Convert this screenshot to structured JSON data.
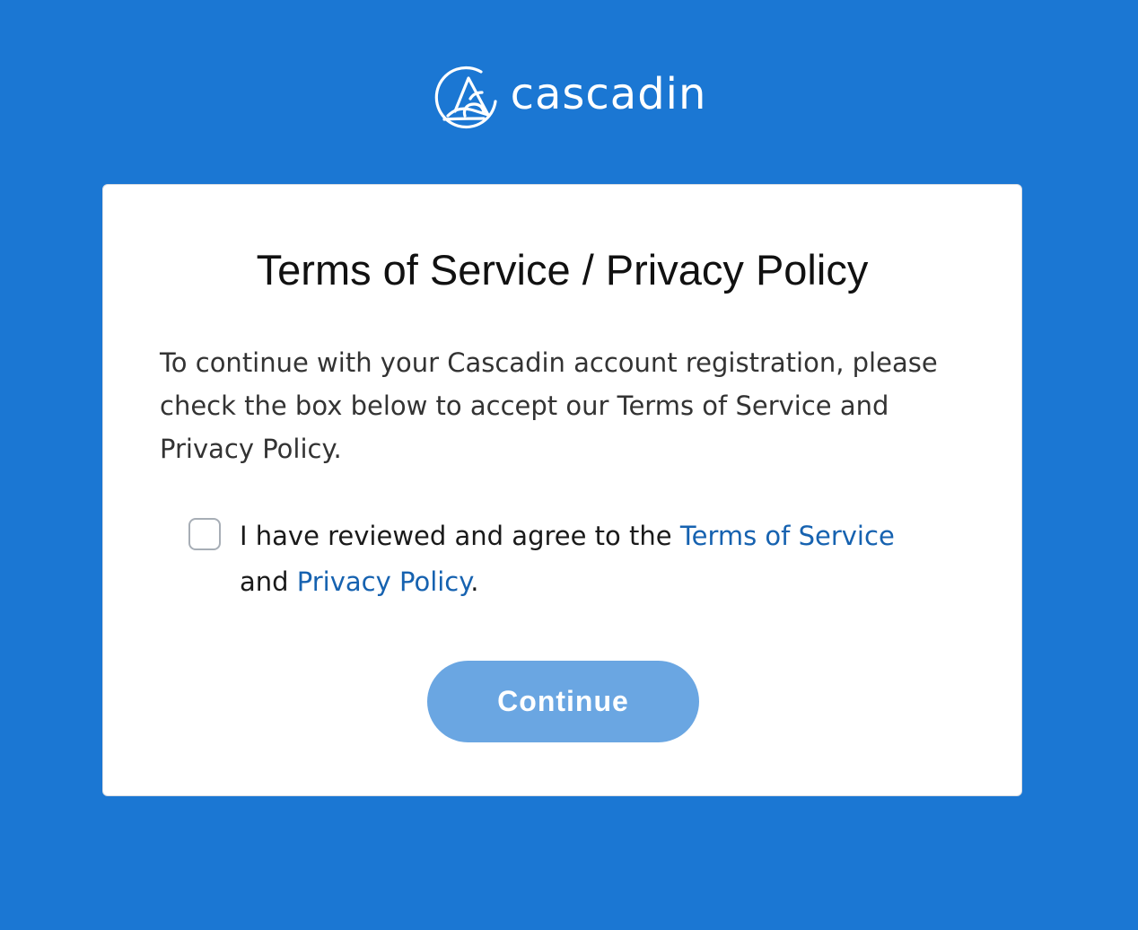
{
  "brand": {
    "name": "cascadin",
    "logo_icon": "cascadin-logo-icon"
  },
  "dialog": {
    "title": "Terms of Service / Privacy Policy",
    "body": "To continue with your Cascadin account registration, please check the box below to accept our Terms of Service and Privacy Policy.",
    "agreement": {
      "checked": false,
      "text_before": "I have reviewed and agree to the ",
      "terms_link": "Terms of Service",
      "text_middle": "and ",
      "privacy_link": "Privacy Policy",
      "text_after": "."
    },
    "continue_label": "Continue"
  },
  "colors": {
    "background": "#1b77d3",
    "card": "#ffffff",
    "link": "#1662b0",
    "button_disabled": "#6aa6e2"
  }
}
